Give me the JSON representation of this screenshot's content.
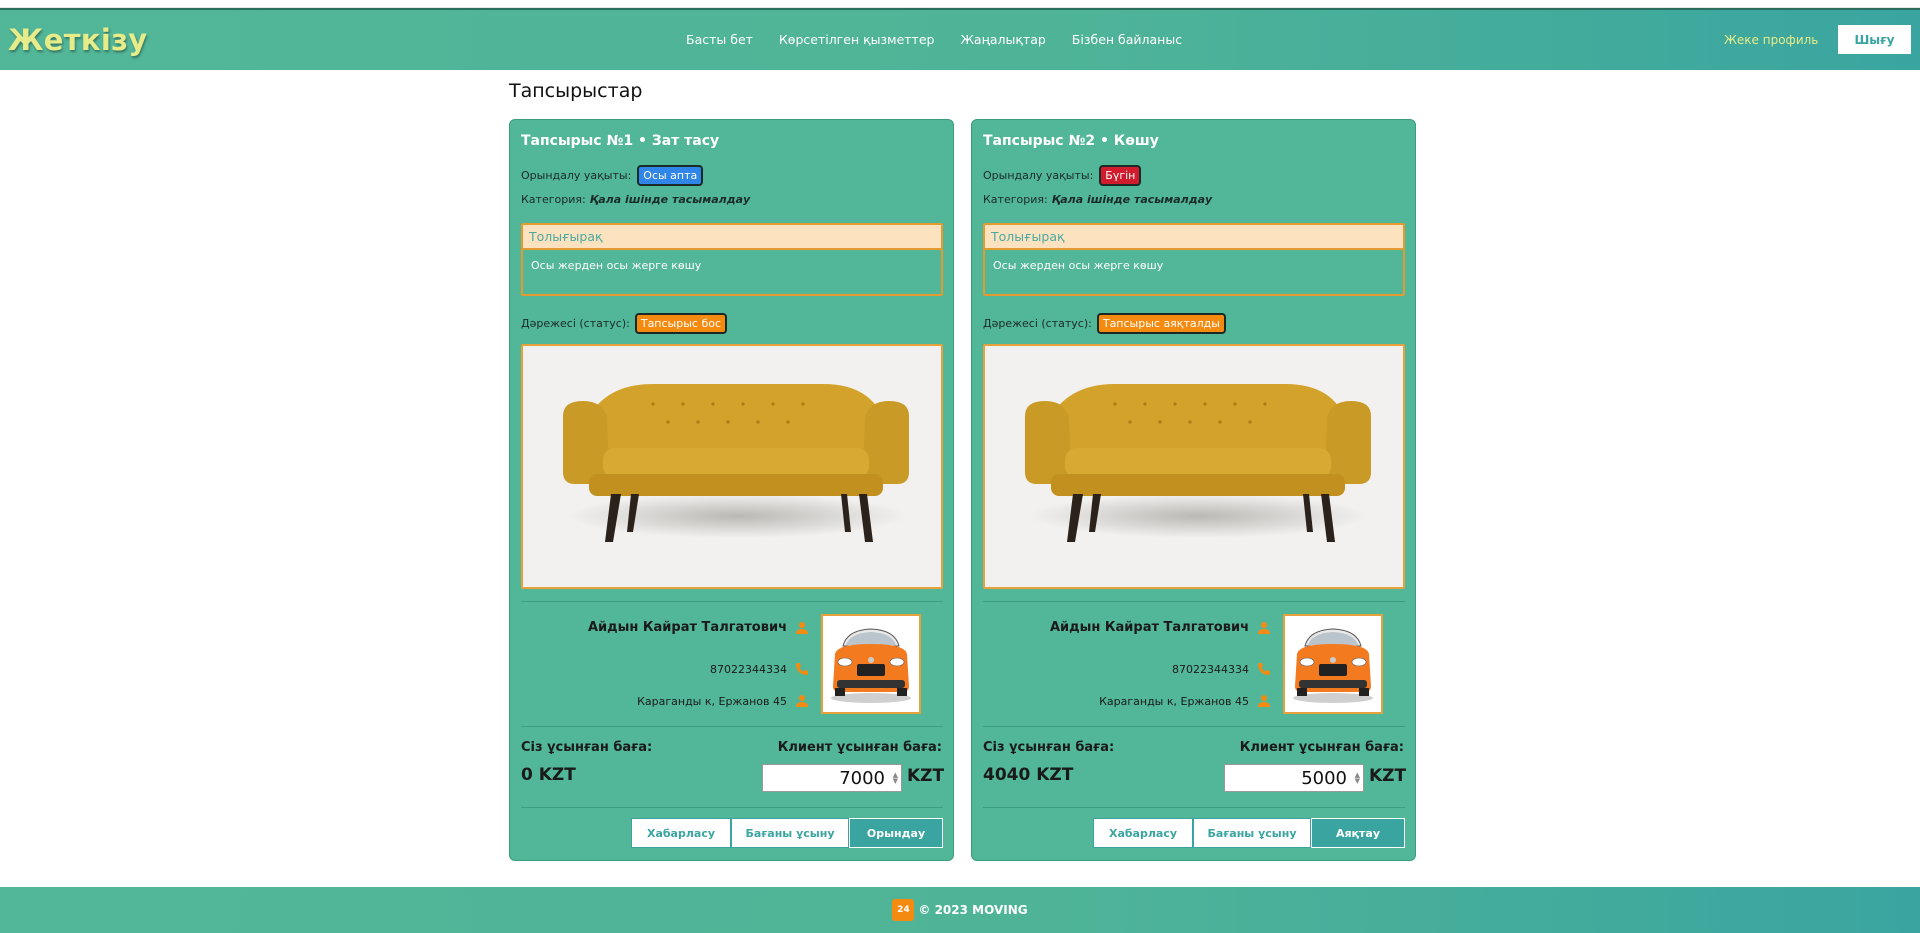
{
  "header": {
    "brand": "Жеткізу",
    "nav": [
      "Басты бет",
      "Көрсетілген қызметтер",
      "Жаңалықтар",
      "Бізбен байланыс"
    ],
    "profile_link": "Жеке профиль",
    "logout_label": "Шығу"
  },
  "page_title": "Тапсырыстар",
  "orders": [
    {
      "title": "Тапсырыс №1 • Зат тасу",
      "time_label": "Орындалу уақыты:",
      "time_badge": "Осы апта",
      "time_badge_color": "#2f86e8",
      "category_label": "Категория:",
      "category_value": "Қала ішінде тасымалдау",
      "details_title": "Толығырақ",
      "details_text": "Осы жерден осы жерге көшу",
      "status_label": "Дәрежесі (статус):",
      "status_badge": "Тапсырыс бос",
      "driver_name": "Айдын Кайрат Талгатович",
      "driver_phone": "87022344334",
      "driver_address": "Караганды к, Ержанов 45",
      "your_price_label": "Сіз ұсынған баға:",
      "your_price_value": "0 KZT",
      "client_price_label": "Клиент ұсынған баға:",
      "client_price_value": "7000",
      "client_price_currency": "KZT",
      "btn_contact": "Хабарласу",
      "btn_offer": "Бағаны ұсыну",
      "btn_primary": "Орындау"
    },
    {
      "title": "Тапсырыс №2 • Көшу",
      "time_label": "Орындалу уақыты:",
      "time_badge": "Бүгін",
      "time_badge_color": "#d01c2c",
      "category_label": "Категория:",
      "category_value": "Қала ішінде тасымалдау",
      "details_title": "Толығырақ",
      "details_text": "Осы жерден осы жерге көшу",
      "status_label": "Дәрежесі (статус):",
      "status_badge": "Тапсырыс аяқталды",
      "driver_name": "Айдын Кайрат Талгатович",
      "driver_phone": "87022344334",
      "driver_address": "Караганды к, Ержанов 45",
      "your_price_label": "Сіз ұсынған баға:",
      "your_price_value": "4040 KZT",
      "client_price_label": "Клиент ұсынған баға:",
      "client_price_value": "5000",
      "client_price_currency": "KZT",
      "btn_contact": "Хабарласу",
      "btn_offer": "Бағаны ұсыну",
      "btn_primary": "Аяқтау"
    }
  ],
  "footer": {
    "text": "© 2023 MOVING"
  }
}
